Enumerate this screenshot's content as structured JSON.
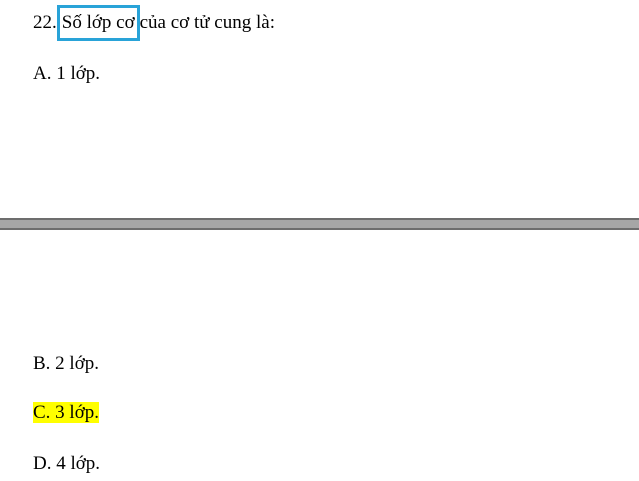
{
  "question": {
    "number": "22.",
    "selected_text": "Số lớp cơ",
    "rest_text": "của cơ tử cung là:"
  },
  "options": [
    {
      "text": "A. 1 lớp."
    },
    {
      "text": "B. 2 lớp."
    },
    {
      "text": "C. 3 lớp.",
      "highlighted": true,
      "highlight_color": "#ffff00"
    },
    {
      "text": "D. 4 lớp."
    }
  ],
  "colors": {
    "selection_border": "#29a3d8",
    "page_gap": "#a6a6a6"
  }
}
